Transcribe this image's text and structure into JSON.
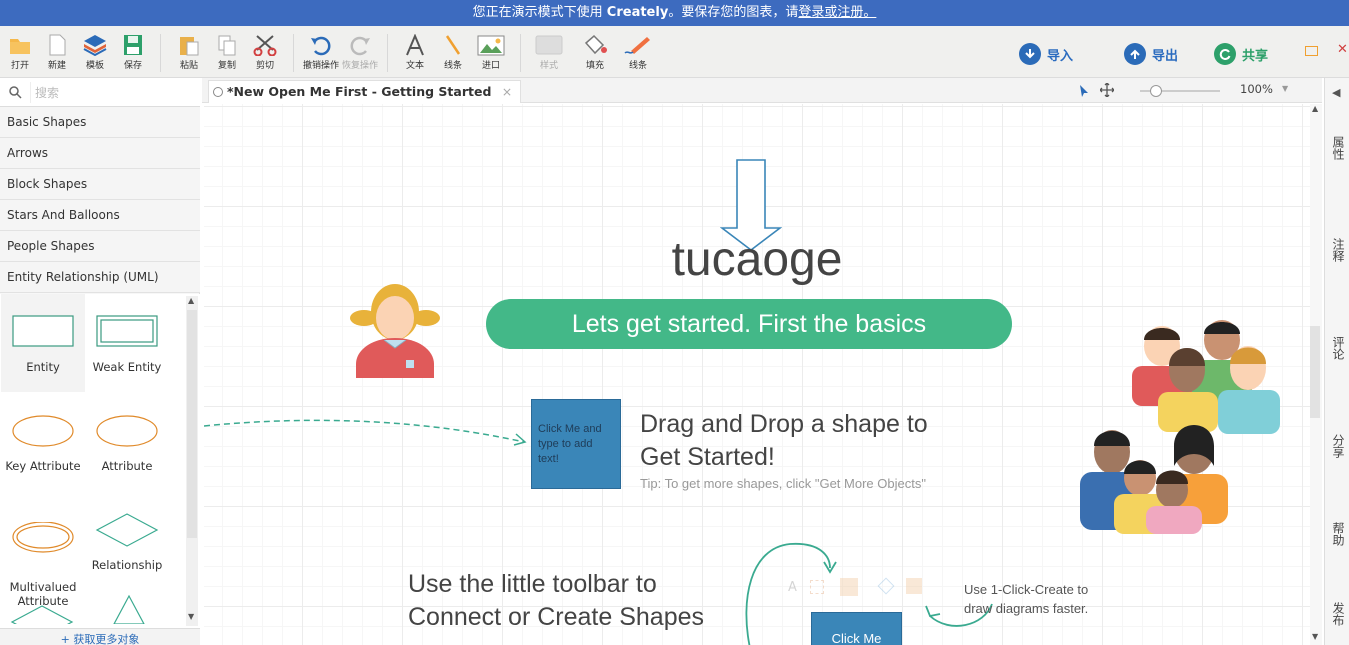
{
  "banner": {
    "text1": "您正在演示模式下使用 ",
    "brand": "Creately",
    "text2": "。要保存您的图表，请",
    "link": "登录或注册。"
  },
  "toolbar": {
    "items": [
      {
        "label": "打开"
      },
      {
        "label": "新建"
      },
      {
        "label": "模板"
      },
      {
        "label": "保存"
      },
      {
        "label": "粘贴"
      },
      {
        "label": "复制"
      },
      {
        "label": "剪切"
      },
      {
        "label": "撤销操作"
      },
      {
        "label": "恢复操作"
      },
      {
        "label": "文本"
      },
      {
        "label": "线条"
      },
      {
        "label": "进口"
      },
      {
        "label": "样式"
      },
      {
        "label": "填充"
      },
      {
        "label": "线条"
      }
    ],
    "import": "导入",
    "export": "导出",
    "share": "共享"
  },
  "search": {
    "placeholder": "搜索"
  },
  "categories": [
    "Basic Shapes",
    "Arrows",
    "Block Shapes",
    "Stars And Balloons",
    "People Shapes",
    "Entity Relationship (UML)"
  ],
  "shapes": [
    {
      "label": "Entity"
    },
    {
      "label": "Weak Entity"
    },
    {
      "label": "Key Attribute"
    },
    {
      "label": "Attribute"
    },
    {
      "label": "Multivalued\nAttribute"
    },
    {
      "label": "Relationship"
    }
  ],
  "more_shapes": "+ 获取更多对象",
  "tab": {
    "title": "*New Open Me First - Getting Started"
  },
  "zoom": "100%",
  "canvas": {
    "title": "tucaoge",
    "banner": "Lets get started. First the basics",
    "box_text": "Click Me and type to add text!",
    "drag_title_1": "Drag and Drop a shape to",
    "drag_title_2": "Get Started!",
    "tip": "Tip: To get more shapes, click  \"Get More Objects\"",
    "toolbar_title_1": "Use the little toolbar to",
    "toolbar_title_2": "Connect or Create Shapes",
    "oneclick_1": "Use 1-Click-Create to",
    "oneclick_2": "draw diagrams faster.",
    "clickme": "Click Me"
  },
  "rightbar": [
    "属性",
    "注释",
    "评论",
    "分享",
    "帮助",
    "发布"
  ],
  "colors": {
    "banner": "#3d6bbf",
    "green": "#43b888",
    "blue_box": "#3a86b8"
  }
}
